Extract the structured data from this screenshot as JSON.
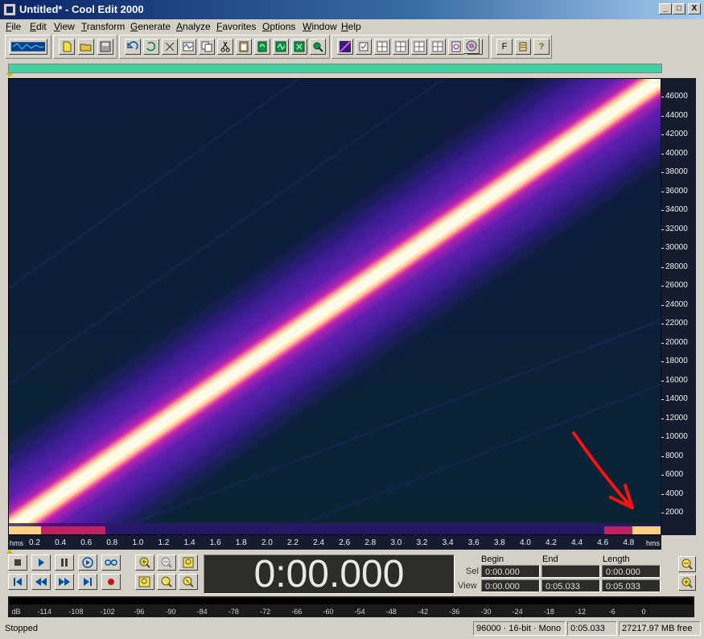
{
  "window": {
    "title": "Untitled* - Cool Edit 2000",
    "minimize": "_",
    "maximize": "□",
    "close": "X"
  },
  "menu": [
    "File",
    "Edit",
    "View",
    "Transform",
    "Generate",
    "Analyze",
    "Favorites",
    "Options",
    "Window",
    "Help"
  ],
  "toolbar": {
    "icons": [
      "waveform-view-icon",
      "new-file-icon",
      "open-file-icon",
      "save-icon",
      "undo-icon",
      "repeat-icon",
      "cut-scissors-icon",
      "copy-icon",
      "copy-to-new-icon",
      "cut-icon",
      "paste-icon",
      "paste-new-icon",
      "mix-paste-icon",
      "trim-icon",
      "insert-cue-icon",
      "spectral-view-icon",
      "snap-icon",
      "grid-1-icon",
      "grid-2-icon",
      "grid-3-icon",
      "grid-4-icon",
      "cd-icon",
      "play-list-icon",
      "cd-burn-icon",
      "favorites-icon",
      "scripts-icon",
      "help-icon"
    ],
    "labels": {
      "favorites": "F",
      "help": "?"
    }
  },
  "spectral": {
    "freq_ticks": [
      "46000",
      "44000",
      "42000",
      "40000",
      "38000",
      "36000",
      "34000",
      "32000",
      "30000",
      "28000",
      "26000",
      "24000",
      "22000",
      "20000",
      "18000",
      "16000",
      "14000",
      "12000",
      "10000",
      "8000",
      "6000",
      "4000",
      "2000"
    ],
    "time_unit": "hms",
    "time_ticks": [
      "0.2",
      "0.4",
      "0.6",
      "0.8",
      "1.0",
      "1.2",
      "1.4",
      "1.6",
      "1.8",
      "2.0",
      "2.2",
      "2.4",
      "2.6",
      "2.8",
      "3.0",
      "3.2",
      "3.4",
      "3.6",
      "3.8",
      "4.0",
      "4.2",
      "4.4",
      "4.6",
      "4.8"
    ],
    "colors": {
      "background": "#0c2038",
      "sweep_core": "#fff8d8",
      "sweep_glow": "#c020c0",
      "arrow": "#ff1010"
    }
  },
  "transport": {
    "icons": [
      "stop-icon",
      "play-icon",
      "pause-icon",
      "play-to-end-icon",
      "loop-icon",
      "go-to-beginning-icon",
      "rewind-icon",
      "fast-forward-icon",
      "go-to-end-icon",
      "record-icon"
    ]
  },
  "zoom": {
    "icons": [
      "zoom-in-horizontal-icon",
      "zoom-out-horizontal-icon",
      "zoom-full-icon",
      "zoom-left-icon",
      "zoom-right-icon",
      "zoom-selection-icon",
      "zoom-in-vertical-icon",
      "zoom-out-vertical-icon"
    ]
  },
  "time_display": "0:00.000",
  "selection": {
    "headers": {
      "begin": "Begin",
      "end": "End",
      "length": "Length"
    },
    "rows": {
      "sel": {
        "label": "Sel",
        "begin": "0:00.000",
        "end": "",
        "length": "0:00.000"
      },
      "view": {
        "label": "View",
        "begin": "0:00.000",
        "end": "0:05.033",
        "length": "0:05.033"
      }
    }
  },
  "level_meter": {
    "ticks": [
      "dB",
      "-114",
      "-108",
      "-102",
      "-96",
      "-90",
      "-84",
      "-78",
      "-72",
      "-66",
      "-60",
      "-54",
      "-48",
      "-42",
      "-36",
      "-30",
      "-24",
      "-18",
      "-12",
      "-6",
      "0"
    ]
  },
  "status": {
    "state": "Stopped",
    "format": "96000 · 16-bit · Mono",
    "duration": "0:05.033",
    "free": "27217.97 MB free"
  }
}
